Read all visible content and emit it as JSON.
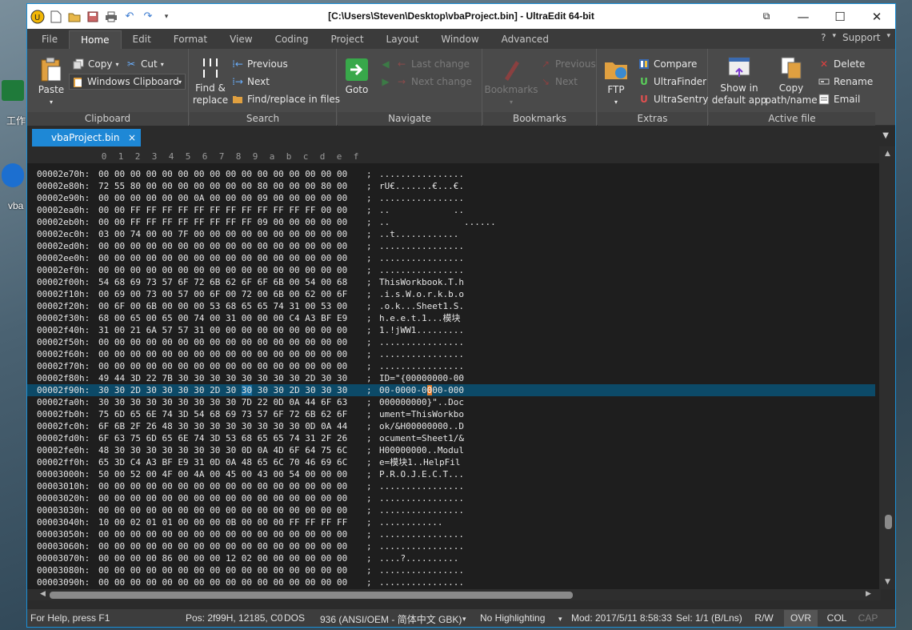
{
  "desktop": {
    "label1": "工作",
    "label2": "vba"
  },
  "window": {
    "title": "[C:\\Users\\Steven\\Desktop\\vbaProject.bin] - UltraEdit 64-bit"
  },
  "menu": {
    "tabs": [
      "File",
      "Home",
      "Edit",
      "Format",
      "View",
      "Coding",
      "Project",
      "Layout",
      "Window",
      "Advanced"
    ],
    "right": {
      "help": "?",
      "support": "Support"
    }
  },
  "ribbon": {
    "clipboard": {
      "paste": "Paste",
      "copy": "Copy",
      "cut": "Cut",
      "windows_clipboard": "Windows Clipboard",
      "group": "Clipboard"
    },
    "search": {
      "find_replace": "Find &\nreplace",
      "previous": "Previous",
      "next": "Next",
      "find_in_files": "Find/replace in files",
      "group": "Search"
    },
    "navigate": {
      "goto": "Goto",
      "last_change": "Last change",
      "next_change": "Next change",
      "group": "Navigate"
    },
    "bookmarks": {
      "bookmarks": "Bookmarks",
      "previous": "Previous",
      "next": "Next",
      "group": "Bookmarks"
    },
    "extras": {
      "ftp": "FTP",
      "compare": "Compare",
      "ultrafinder": "UltraFinder",
      "ultrasentry": "UltraSentry",
      "group": "Extras"
    },
    "active_file": {
      "show_in_app": "Show in\ndefault app",
      "copy_path": "Copy\npath/name",
      "delete": "Delete",
      "rename": "Rename",
      "email": "Email",
      "group": "Active file"
    }
  },
  "document": {
    "tab_label": "vbaProject.bin",
    "close": "×"
  },
  "editor": {
    "ruler": [
      "0",
      "1",
      "2",
      "3",
      "4",
      "5",
      "6",
      "7",
      "8",
      "9",
      "a",
      "b",
      "c",
      "d",
      "e",
      "f"
    ],
    "rows": [
      {
        "addr": "00002e70h:",
        "hex": "00 00 00 00 00 00 00 00 00 00 00 00 00 00 00 00",
        "ascii": "................"
      },
      {
        "addr": "00002e80h:",
        "hex": "72 55 80 00 00 00 00 00 00 00 80 00 00 00 80 00",
        "ascii": "rU€.......€...€."
      },
      {
        "addr": "00002e90h:",
        "hex": "00 00 00 00 00 00 0A 00 00 00 09 00 00 00 00 00",
        "ascii": "................"
      },
      {
        "addr": "00002ea0h:",
        "hex": "00 00 FF FF FF FF FF FF FF FF FF FF FF FF 00 00",
        "ascii": "..            .."
      },
      {
        "addr": "00002eb0h:",
        "hex": "00 00 FF FF FF FF FF FF FF FF 09 00 00 00 00 00",
        "ascii": "..              ......"
      },
      {
        "addr": "00002ec0h:",
        "hex": "03 00 74 00 00 7F 00 00 00 00 00 00 00 00 00 00",
        "ascii": "..t............"
      },
      {
        "addr": "00002ed0h:",
        "hex": "00 00 00 00 00 00 00 00 00 00 00 00 00 00 00 00",
        "ascii": "................"
      },
      {
        "addr": "00002ee0h:",
        "hex": "00 00 00 00 00 00 00 00 00 00 00 00 00 00 00 00",
        "ascii": "................"
      },
      {
        "addr": "00002ef0h:",
        "hex": "00 00 00 00 00 00 00 00 00 00 00 00 00 00 00 00",
        "ascii": "................"
      },
      {
        "addr": "00002f00h:",
        "hex": "54 68 69 73 57 6F 72 6B 62 6F 6F 6B 00 54 00 68",
        "ascii": "ThisWorkbook.T.h"
      },
      {
        "addr": "00002f10h:",
        "hex": "00 69 00 73 00 57 00 6F 00 72 00 6B 00 62 00 6F",
        "ascii": ".i.s.W.o.r.k.b.o"
      },
      {
        "addr": "00002f20h:",
        "hex": "00 6F 00 6B 00 00 00 53 68 65 65 74 31 00 53 00",
        "ascii": ".o.k...Sheet1.S."
      },
      {
        "addr": "00002f30h:",
        "hex": "68 00 65 00 65 00 74 00 31 00 00 00 C4 A3 BF E9",
        "ascii": "h.e.e.t.1...模块"
      },
      {
        "addr": "00002f40h:",
        "hex": "31 00 21 6A 57 57 31 00 00 00 00 00 00 00 00 00",
        "ascii": "1.!jWW1........."
      },
      {
        "addr": "00002f50h:",
        "hex": "00 00 00 00 00 00 00 00 00 00 00 00 00 00 00 00",
        "ascii": "................"
      },
      {
        "addr": "00002f60h:",
        "hex": "00 00 00 00 00 00 00 00 00 00 00 00 00 00 00 00",
        "ascii": "................"
      },
      {
        "addr": "00002f70h:",
        "hex": "00 00 00 00 00 00 00 00 00 00 00 00 00 00 00 00",
        "ascii": "................"
      },
      {
        "addr": "00002f80h:",
        "hex": "49 44 3D 22 7B 30 30 30 30 30 30 30 30 2D 30 30",
        "ascii": "ID=\"{00000000-00"
      },
      {
        "addr": "00002f90h:",
        "hex": "30 30 2D 30 30 30 30 2D 30 30 30 30 2D 30 30 30",
        "ascii": "00-0000-0000-000",
        "selected": true
      },
      {
        "addr": "00002fa0h:",
        "hex": "30 30 30 30 30 30 30 30 30 7D 22 0D 0A 44 6F 63",
        "ascii": "000000000}\"..Doc"
      },
      {
        "addr": "00002fb0h:",
        "hex": "75 6D 65 6E 74 3D 54 68 69 73 57 6F 72 6B 62 6F",
        "ascii": "ument=ThisWorkbo"
      },
      {
        "addr": "00002fc0h:",
        "hex": "6F 6B 2F 26 48 30 30 30 30 30 30 30 30 0D 0A 44",
        "ascii": "ok/&H00000000..D"
      },
      {
        "addr": "00002fd0h:",
        "hex": "6F 63 75 6D 65 6E 74 3D 53 68 65 65 74 31 2F 26",
        "ascii": "ocument=Sheet1/&"
      },
      {
        "addr": "00002fe0h:",
        "hex": "48 30 30 30 30 30 30 30 30 0D 0A 4D 6F 64 75 6C",
        "ascii": "H00000000..Modul"
      },
      {
        "addr": "00002ff0h:",
        "hex": "65 3D C4 A3 BF E9 31 0D 0A 48 65 6C 70 46 69 6C",
        "ascii": "e=模块1..HelpFil"
      },
      {
        "addr": "00003000h:",
        "hex": "50 00 52 00 4F 00 4A 00 45 00 43 00 54 00 00 00",
        "ascii": "P.R.O.J.E.C.T..."
      },
      {
        "addr": "00003010h:",
        "hex": "00 00 00 00 00 00 00 00 00 00 00 00 00 00 00 00",
        "ascii": "................"
      },
      {
        "addr": "00003020h:",
        "hex": "00 00 00 00 00 00 00 00 00 00 00 00 00 00 00 00",
        "ascii": "................"
      },
      {
        "addr": "00003030h:",
        "hex": "00 00 00 00 00 00 00 00 00 00 00 00 00 00 00 00",
        "ascii": "................"
      },
      {
        "addr": "00003040h:",
        "hex": "10 00 02 01 01 00 00 00 0B 00 00 00 FF FF FF FF",
        "ascii": "............"
      },
      {
        "addr": "00003050h:",
        "hex": "00 00 00 00 00 00 00 00 00 00 00 00 00 00 00 00",
        "ascii": "................"
      },
      {
        "addr": "00003060h:",
        "hex": "00 00 00 00 00 00 00 00 00 00 00 00 00 00 00 00",
        "ascii": "................"
      },
      {
        "addr": "00003070h:",
        "hex": "00 00 00 00 86 00 00 00 12 02 00 00 00 00 00 00",
        "ascii": "....?.........."
      },
      {
        "addr": "00003080h:",
        "hex": "00 00 00 00 00 00 00 00 00 00 00 00 00 00 00 00",
        "ascii": "................"
      },
      {
        "addr": "00003090h:",
        "hex": "00 00 00 00 00 00 00 00 00 00 00 00 00 00 00 00",
        "ascii": "................"
      }
    ]
  },
  "status": {
    "help": "For Help, press F1",
    "position": "Pos: 2f99H, 12185, C0",
    "line_ending": "DOS",
    "encoding": "936  (ANSI/OEM - 简体中文 GBK)",
    "highlighting": "No Highlighting",
    "modified": "Mod: 2017/5/11 8:58:33",
    "selection": "Sel: 1/1 (B/Lns)",
    "rw": "R/W",
    "ovr": "OVR",
    "col": "COL",
    "cap": "CAP"
  },
  "colors": {
    "accent": "#1e88d6",
    "selection_row": "#0c4a68",
    "caret": "#e07a2a"
  }
}
